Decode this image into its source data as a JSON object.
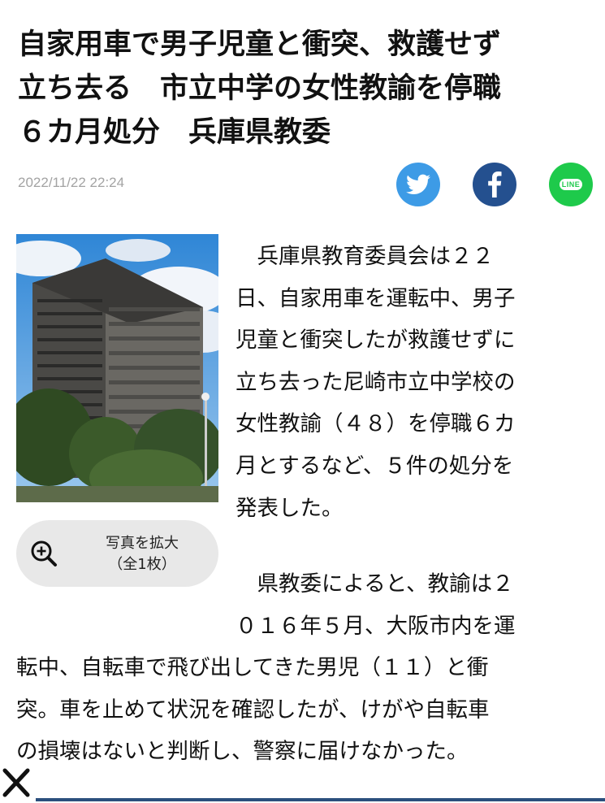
{
  "article": {
    "title": "自家用車で男子児童と衝突、救護せず\n立ち去る　市立中学の女性教諭を停職\n６カ月処分　兵庫県教委",
    "date": "2022/11/22 22:24"
  },
  "share": {
    "twitter_icon": "twitter-bird-icon",
    "facebook_icon": "facebook-f-icon",
    "line_label": "LINE"
  },
  "photo": {
    "zoom_line1": "写真を拡大",
    "zoom_line2": "（全1枚）",
    "zoom_icon": "zoom-in-icon"
  },
  "body": {
    "p1_lines": [
      "　兵庫県教育委員会は２２",
      "日、自家用車を運転中、男子",
      "児童と衝突したが救護せずに",
      "立ち去った尼崎市立中学校の",
      "女性教諭（４８）を停職６カ",
      "月とするなど、５件の処分を",
      "発表した。"
    ],
    "p2_lines_narrow": [
      "　県教委によると、教諭は２",
      "０１６年５月、大阪市内を運"
    ],
    "p2_lines_wide": [
      "転中、自転車で飛び出してきた男児（１１）と衝",
      "突。車を止めて状況を確認したが、けがや自転車",
      "の損壊はないと判断し、警察に届けなかった。"
    ]
  },
  "colors": {
    "twitter": "#3d9be6",
    "facebook": "#24508f",
    "line": "#1eca4b",
    "date": "#a3a3a3",
    "bottom_bar": "#2b4f7d"
  }
}
